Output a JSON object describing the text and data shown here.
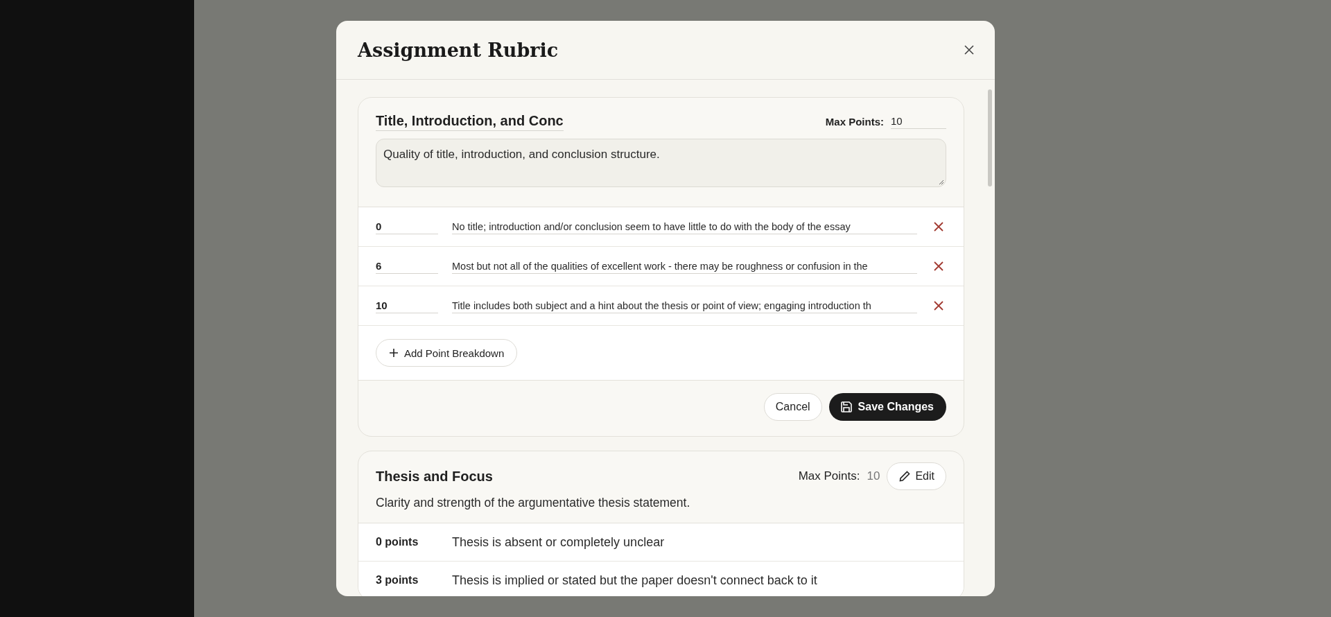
{
  "dialog": {
    "title": "Assignment Rubric",
    "criteria": [
      {
        "kind": "editing",
        "name": "Title, Introduction, and Conc",
        "max_points_label": "Max Points:",
        "max_points": "10",
        "description": "Quality of title, introduction, and conclusion structure.",
        "levels": [
          {
            "points": "0",
            "text": "No title; introduction and/or conclusion seem to have little to do with the body of the essay"
          },
          {
            "points": "6",
            "text": "Most but not all of the qualities of excellent work - there may be roughness or confusion in the"
          },
          {
            "points": "10",
            "text": "Title includes both subject and a hint about the thesis or point of view; engaging introduction th"
          }
        ],
        "add_label": "Add Point Breakdown",
        "cancel_label": "Cancel",
        "save_label": "Save Changes"
      },
      {
        "kind": "view",
        "name": "Thesis and Focus",
        "max_points_label": "Max Points:",
        "max_points": "10",
        "edit_label": "Edit",
        "description": "Clarity and strength of the argumentative thesis statement.",
        "levels": [
          {
            "points": "0 points",
            "text": "Thesis is absent or completely unclear"
          },
          {
            "points": "3 points",
            "text": "Thesis is implied or stated but the paper doesn't connect back to it"
          }
        ]
      }
    ]
  }
}
